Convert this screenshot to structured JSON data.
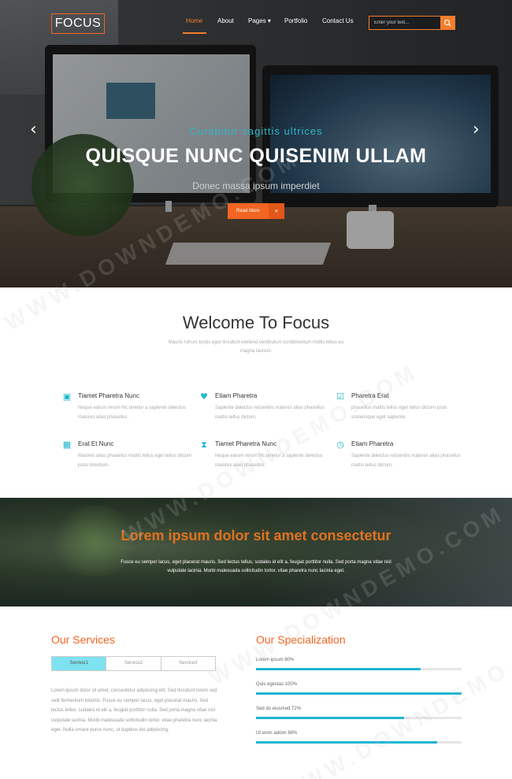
{
  "nav": {
    "logo": "FOCUS",
    "menu": [
      {
        "label": "Home",
        "active": true
      },
      {
        "label": "About",
        "active": false
      },
      {
        "label": "Pages ▾",
        "active": false
      },
      {
        "label": "Portfolio",
        "active": false
      },
      {
        "label": "Contact Us",
        "active": false
      }
    ],
    "search_placeholder": "Enter your text..."
  },
  "hero": {
    "subtitle": "Curabitur sagittis ultrices",
    "title": "QUISQUE NUNC QUISENIM ULLAM",
    "tagline": "Donec massa ipsum imperdiet",
    "button_label": "Read More",
    "button_icon": "»",
    "prev_icon": "‹",
    "next_icon": "›"
  },
  "welcome": {
    "title": "Welcome To Focus",
    "text": "Mauris rutrum turpis eget tincidunt eleifend vestibulum condimentum mollis tellus eu magna laoreet."
  },
  "features": [
    {
      "icon": "briefcase-icon",
      "glyph": "▣",
      "title": "Tiamet Pharetra Nunc",
      "text": "Neque earum rerum hic tenetur a sapiente delectus maiores alias phasellus."
    },
    {
      "icon": "heart-icon",
      "glyph": "♥",
      "title": "Etiam Pharetra",
      "text": "Sapiente delectus reiciendis maiores alias phasellus mattis tellus dictum."
    },
    {
      "icon": "checkbox-icon",
      "glyph": "☑",
      "title": "Pharetra Erat",
      "text": "phasellus mattis tellus eget tellus dictum justo scelerisque eget sapiente."
    },
    {
      "icon": "calendar-icon",
      "glyph": "▦",
      "title": "Erat Et Nunc",
      "text": "Maiores alias phasellus mattis tellus eget tellus dictum justo interdum."
    },
    {
      "icon": "hourglass-icon",
      "glyph": "⧗",
      "title": "Tiamet Pharetra Nunc",
      "text": "Neque earum rerum hic tenetur a sapiente delectus maiores alias phasellus."
    },
    {
      "icon": "clock-icon",
      "glyph": "◷",
      "title": "Etiam Pharetra",
      "text": "Sapiente delectus reiciendis maiores alias phasellus mattis tellus dictum."
    }
  ],
  "banner": {
    "title": "Lorem ipsum dolor sit amet consectetur",
    "text": "Fusce eu semper lacus, eget placerat mauris. Sed lectus tellus, sodales id elit a, feugiat porttitor nulla. Sed porta magna vitae nisl vulputate lacinia. Morbi malesuada sollicitudin tortor, vitae pharetra nunc lacinia eget."
  },
  "services": {
    "title": "Our Services",
    "tabs": [
      "Service1",
      "Service2",
      "Service3"
    ],
    "active_tab": 0,
    "text": "Lorem ipsum dolor sit amet, consectetur adipiscing elit. Sed tincidunt lorem sed velit fermentum lobortis. Fusce eu semper lacus, eget placerat mauris. Sed lectus tellus, sodales id elit a, feugiat porttitor nulla. Sed porta magna vitae nisl vulputate lacinia. Morbi malesuada sollicitudin tortor, vitae pharetra nunc lacinia eget. Nulla ornare purus nunc, ut dapibus leo adipiscing."
  },
  "specialization": {
    "title": "Our Specialization",
    "skills": [
      {
        "label": "Lorem ipsum   80%",
        "percent": 80
      },
      {
        "label": "Quis egestas   100%",
        "percent": 100
      },
      {
        "label": "Sed do eiusmod   72%",
        "percent": 72
      },
      {
        "label": "Ut enim adnim   88%",
        "percent": 88
      }
    ]
  },
  "colors": {
    "accent_orange": "#f26522",
    "accent_cyan": "#1fb6d0",
    "hero_subtitle": "#2fb6c9",
    "tab_active": "#7fe2f0"
  },
  "watermark": "WWW.DOWNDEMO.COM"
}
